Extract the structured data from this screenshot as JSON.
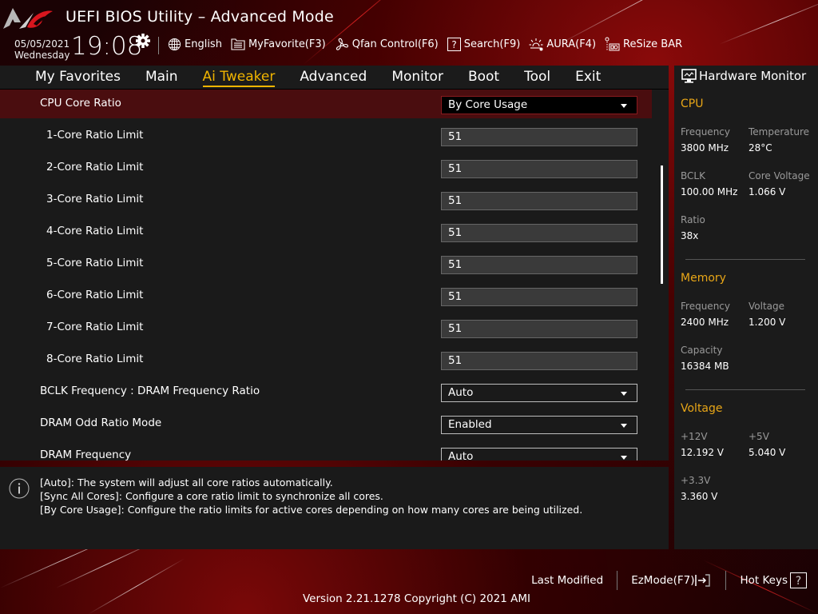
{
  "window": {
    "title": "UEFI BIOS Utility – Advanced Mode"
  },
  "header": {
    "date": "05/05/2021",
    "weekday": "Wednesday",
    "time": "19:08",
    "toolbar": [
      {
        "icon": "globe-icon",
        "label": "English"
      },
      {
        "icon": "favorites-list-icon",
        "label": "MyFavorite(F3)"
      },
      {
        "icon": "fan-icon",
        "label": "Qfan Control(F6)"
      },
      {
        "icon": "question-box-icon",
        "label": "Search(F9)"
      },
      {
        "icon": "aura-light-icon",
        "label": "AURA(F4)"
      },
      {
        "icon": "resize-bar-card-icon",
        "label": "ReSize BAR"
      }
    ]
  },
  "menu": {
    "tabs": [
      {
        "label": "My Favorites",
        "active": false
      },
      {
        "label": "Main",
        "active": false
      },
      {
        "label": "Ai Tweaker",
        "active": true
      },
      {
        "label": "Advanced",
        "active": false
      },
      {
        "label": "Monitor",
        "active": false
      },
      {
        "label": "Boot",
        "active": false
      },
      {
        "label": "Tool",
        "active": false
      },
      {
        "label": "Exit",
        "active": false
      }
    ]
  },
  "settings": [
    {
      "label": "CPU Core Ratio",
      "value": "By Core Usage",
      "type": "select",
      "selected": true,
      "indent": false
    },
    {
      "label": "1-Core Ratio Limit",
      "value": "51",
      "type": "input",
      "indent": true
    },
    {
      "label": "2-Core Ratio Limit",
      "value": "51",
      "type": "input",
      "indent": true
    },
    {
      "label": "3-Core Ratio Limit",
      "value": "51",
      "type": "input",
      "indent": true
    },
    {
      "label": "4-Core Ratio Limit",
      "value": "51",
      "type": "input",
      "indent": true
    },
    {
      "label": "5-Core Ratio Limit",
      "value": "51",
      "type": "input",
      "indent": true
    },
    {
      "label": "6-Core Ratio Limit",
      "value": "51",
      "type": "input",
      "indent": true
    },
    {
      "label": "7-Core Ratio Limit",
      "value": "51",
      "type": "input",
      "indent": true
    },
    {
      "label": "8-Core Ratio Limit",
      "value": "51",
      "type": "input",
      "indent": true
    },
    {
      "label": "BCLK Frequency : DRAM Frequency Ratio",
      "value": "Auto",
      "type": "select",
      "indent": false
    },
    {
      "label": "DRAM Odd Ratio Mode",
      "value": "Enabled",
      "type": "select",
      "indent": false
    },
    {
      "label": "DRAM Frequency",
      "value": "Auto",
      "type": "select",
      "indent": false
    }
  ],
  "help": {
    "lines": [
      "[Auto]: The system will adjust all core ratios automatically.",
      "[Sync All Cores]: Configure a core ratio limit to synchronize all cores.",
      "[By Core Usage]: Configure the ratio limits for active cores depending on how many cores are being utilized."
    ]
  },
  "hardware_monitor": {
    "title": "Hardware Monitor",
    "cpu": {
      "heading": "CPU",
      "frequency_label": "Frequency",
      "frequency": "3800 MHz",
      "temperature_label": "Temperature",
      "temperature": "28°C",
      "bclk_label": "BCLK",
      "bclk": "100.00 MHz",
      "core_voltage_label": "Core Voltage",
      "core_voltage": "1.066 V",
      "ratio_label": "Ratio",
      "ratio": "38x"
    },
    "memory": {
      "heading": "Memory",
      "frequency_label": "Frequency",
      "frequency": "2400 MHz",
      "voltage_label": "Voltage",
      "voltage": "1.200 V",
      "capacity_label": "Capacity",
      "capacity": "16384 MB"
    },
    "voltage": {
      "heading": "Voltage",
      "v12_label": "+12V",
      "v12": "12.192 V",
      "v5_label": "+5V",
      "v5": "5.040 V",
      "v33_label": "+3.3V",
      "v33": "3.360 V"
    }
  },
  "footer": {
    "last_modified": "Last Modified",
    "ezmode": "EzMode(F7)",
    "hot_keys": "Hot Keys",
    "version": "Version 2.21.1278 Copyright (C) 2021 AMI"
  },
  "colors": {
    "accent": "#f0b400",
    "section_heading": "#e8a617",
    "selected_row": "#4a0d0f",
    "panel_bg": "#1a1a1a"
  }
}
